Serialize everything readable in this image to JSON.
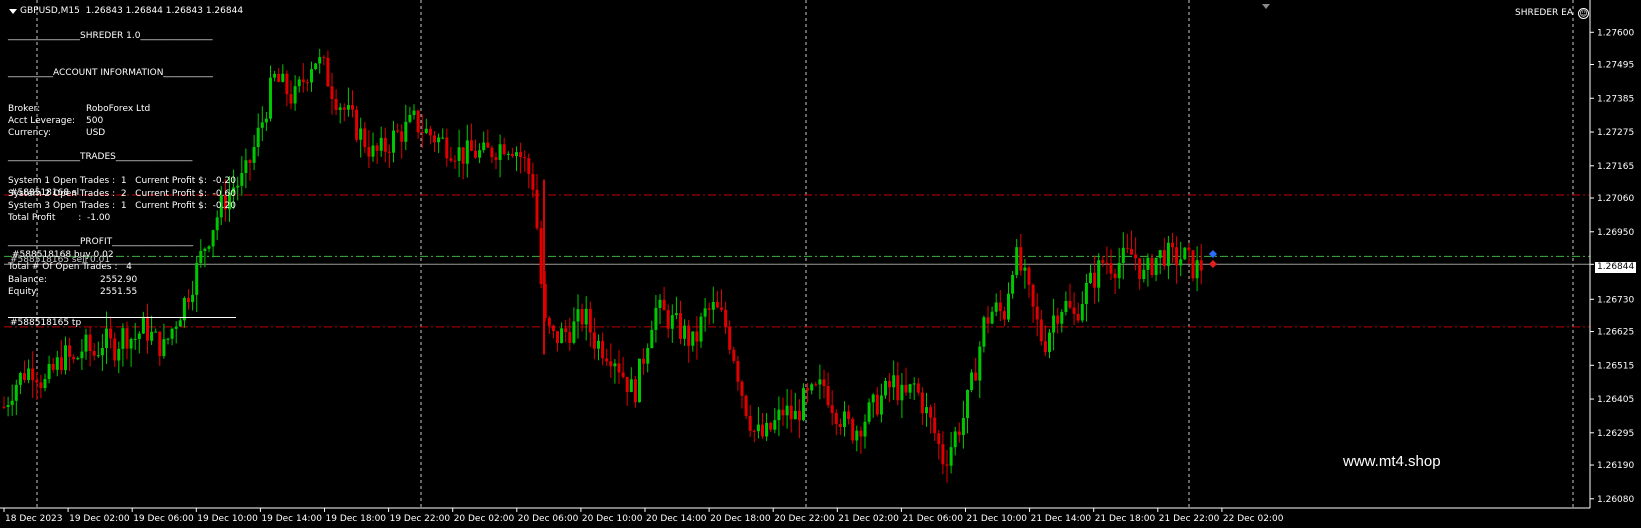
{
  "header": {
    "symbol_info": "GBPUSD,M15  1.26843 1.26844 1.26843 1.26844",
    "ea_name": "SHREDER EA"
  },
  "panel": {
    "title": "________________SHREDER 1.0________________",
    "account_header": "__________ACCOUNT INFORMATION___________",
    "broker_label": "Broker:",
    "broker_value": "RoboForex Ltd",
    "leverage_label": "Acct Leverage:",
    "leverage_value": "500",
    "currency_label": "Currency:",
    "currency_value": "USD",
    "trades_header": "________________TRADES_________________",
    "system1": "System 1 Open Trades :  1   Current Profit $:  -0.20",
    "system2": "System 2 Open Trades :  2   Current Profit $:  -0.60",
    "system2_overlay": "#588518168 sl",
    "system3": "System 3 Open Trades :  1   Current Profit $:  -0.20",
    "total_profit": "Total Profit        :  -1.00",
    "profit_header": "________________PROFIT__________________",
    "order_buy": "#588518168 buy 0.02",
    "order_sell_overlay": "#588518165 sell 0.01",
    "open_trades": "Total # Of Open Trades :   4",
    "balance_label": "Balance:",
    "balance_value": "2552.90",
    "equity_label": "Equity:",
    "equity_value": "2551.55",
    "tp_label": "#588518165 tp"
  },
  "watermark": "www.mt4.shop",
  "current_price": "1.26844",
  "price_axis": [
    "1.27600",
    "1.27495",
    "1.27385",
    "1.27275",
    "1.27165",
    "1.27060",
    "1.26950",
    "1.26844",
    "1.26730",
    "1.26625",
    "1.26515",
    "1.26405",
    "1.26295",
    "1.26190",
    "1.26080"
  ],
  "time_axis": [
    "18 Dec 2023",
    "19 Dec 02:00",
    "19 Dec 06:00",
    "19 Dec 10:00",
    "19 Dec 14:00",
    "19 Dec 18:00",
    "19 Dec 22:00",
    "20 Dec 02:00",
    "20 Dec 06:00",
    "20 Dec 10:00",
    "20 Dec 14:00",
    "20 Dec 18:00",
    "20 Dec 22:00",
    "21 Dec 02:00",
    "21 Dec 06:00",
    "21 Dec 10:00",
    "21 Dec 14:00",
    "21 Dec 18:00",
    "21 Dec 22:00",
    "22 Dec 02:00"
  ],
  "colors": {
    "bull": "#00c800",
    "bear": "#e00000",
    "level_red": "#c00000",
    "level_green": "#3cb43c",
    "grid": "#c8c8c8"
  },
  "chart_data": {
    "type": "candlestick",
    "series": [
      {
        "name": "GBPUSD,M15",
        "close_path": [
          [
            0,
            1.2638
          ],
          [
            10,
            1.2645
          ],
          [
            20,
            1.2649
          ],
          [
            30,
            1.2651
          ],
          [
            40,
            1.2645
          ],
          [
            50,
            1.265
          ],
          [
            60,
            1.2655
          ],
          [
            70,
            1.2652
          ],
          [
            80,
            1.2658
          ],
          [
            90,
            1.2655
          ],
          [
            100,
            1.266
          ],
          [
            110,
            1.2657
          ],
          [
            120,
            1.2662
          ],
          [
            130,
            1.266
          ],
          [
            140,
            1.2664
          ],
          [
            150,
            1.266
          ],
          [
            160,
            1.2657
          ],
          [
            170,
            1.2665
          ],
          [
            180,
            1.2672
          ],
          [
            190,
            1.268
          ],
          [
            200,
            1.269
          ],
          [
            210,
            1.2698
          ],
          [
            220,
            1.2705
          ],
          [
            230,
            1.271
          ],
          [
            240,
            1.2712
          ],
          [
            250,
            1.2722
          ],
          [
            260,
            1.2733
          ],
          [
            270,
            1.2745
          ],
          [
            280,
            1.2742
          ],
          [
            290,
            1.2738
          ],
          [
            300,
            1.2745
          ],
          [
            310,
            1.2752
          ],
          [
            320,
            1.2748
          ],
          [
            330,
            1.274
          ],
          [
            340,
            1.2735
          ],
          [
            350,
            1.273
          ],
          [
            360,
            1.2725
          ],
          [
            370,
            1.272
          ],
          [
            380,
            1.2722
          ],
          [
            390,
            1.2726
          ],
          [
            400,
            1.2728
          ],
          [
            410,
            1.2731
          ],
          [
            420,
            1.2728
          ],
          [
            430,
            1.2726
          ],
          [
            440,
            1.2724
          ],
          [
            450,
            1.2722
          ],
          [
            460,
            1.272
          ],
          [
            470,
            1.2721
          ],
          [
            480,
            1.272
          ],
          [
            490,
            1.2722
          ],
          [
            500,
            1.2724
          ],
          [
            510,
            1.2723
          ],
          [
            520,
            1.2718
          ],
          [
            530,
            1.271
          ],
          [
            540,
            1.2665
          ],
          [
            550,
            1.266
          ],
          [
            560,
            1.2662
          ],
          [
            570,
            1.2664
          ],
          [
            580,
            1.2668
          ],
          [
            590,
            1.266
          ],
          [
            600,
            1.2657
          ],
          [
            610,
            1.2655
          ],
          [
            620,
            1.2648
          ],
          [
            630,
            1.2642
          ],
          [
            640,
            1.2655
          ],
          [
            650,
            1.267
          ],
          [
            660,
            1.2668
          ],
          [
            670,
            1.2665
          ],
          [
            680,
            1.2662
          ],
          [
            690,
            1.2658
          ],
          [
            700,
            1.2668
          ],
          [
            710,
            1.267
          ],
          [
            720,
            1.2666
          ],
          [
            730,
            1.2655
          ],
          [
            740,
            1.264
          ],
          [
            750,
            1.263
          ],
          [
            760,
            1.2628
          ],
          [
            770,
            1.2632
          ],
          [
            780,
            1.2637
          ],
          [
            790,
            1.2634
          ],
          [
            800,
            1.264
          ],
          [
            810,
            1.2642
          ],
          [
            820,
            1.2645
          ],
          [
            830,
            1.2638
          ],
          [
            840,
            1.2633
          ],
          [
            850,
            1.263
          ],
          [
            860,
            1.2634
          ],
          [
            870,
            1.2638
          ],
          [
            880,
            1.2642
          ],
          [
            890,
            1.2646
          ],
          [
            900,
            1.264
          ],
          [
            910,
            1.2645
          ],
          [
            920,
            1.2638
          ],
          [
            930,
            1.263
          ],
          [
            940,
            1.262
          ],
          [
            950,
            1.2628
          ],
          [
            960,
            1.2635
          ],
          [
            970,
            1.2648
          ],
          [
            980,
            1.2665
          ],
          [
            990,
            1.267
          ],
          [
            1000,
            1.2668
          ],
          [
            1010,
            1.2688
          ],
          [
            1020,
            1.268
          ],
          [
            1030,
            1.2668
          ],
          [
            1040,
            1.2658
          ],
          [
            1050,
            1.2668
          ],
          [
            1060,
            1.2672
          ],
          [
            1070,
            1.2667
          ],
          [
            1080,
            1.2675
          ],
          [
            1090,
            1.268
          ],
          [
            1100,
            1.2686
          ],
          [
            1110,
            1.2684
          ],
          [
            1120,
            1.2686
          ],
          [
            1130,
            1.2688
          ],
          [
            1140,
            1.268
          ],
          [
            1150,
            1.2686
          ],
          [
            1160,
            1.2688
          ],
          [
            1170,
            1.2686
          ],
          [
            1180,
            1.2687
          ],
          [
            1190,
            1.2683
          ],
          [
            1200,
            1.2684
          ]
        ]
      }
    ],
    "levels": [
      {
        "name": "sl",
        "price": 1.2707,
        "style": "dash-dot",
        "color": "red"
      },
      {
        "name": "entry-buy",
        "price": 1.2687,
        "style": "dash-dot",
        "color": "green"
      },
      {
        "name": "bid",
        "price": 1.26844,
        "style": "solid",
        "color": "grey"
      },
      {
        "name": "tp",
        "price": 1.2664,
        "style": "dash-dot",
        "color": "red"
      }
    ],
    "ylim": [
      1.2605,
      1.2764
    ],
    "grid": "vertical-dotted"
  }
}
